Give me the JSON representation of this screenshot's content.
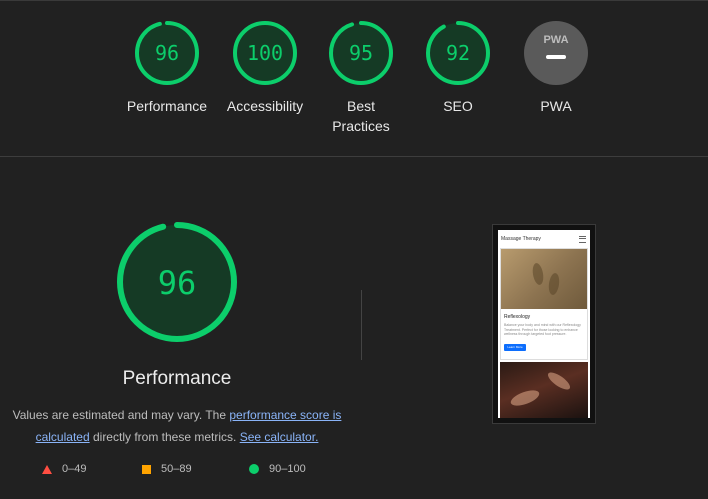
{
  "categories": [
    {
      "score": "96",
      "label": "Performance",
      "value": 96,
      "type": "score"
    },
    {
      "score": "100",
      "label": "Accessibility",
      "value": 100,
      "type": "score"
    },
    {
      "score": "95",
      "label": "Best Practices",
      "value": 95,
      "type": "score"
    },
    {
      "score": "92",
      "label": "SEO",
      "value": 92,
      "type": "score"
    },
    {
      "score": "PWA",
      "label": "PWA",
      "value": null,
      "type": "pwa"
    }
  ],
  "main": {
    "score": "96",
    "value": 96,
    "title": "Performance",
    "desc_part1": "Values are estimated and may vary. The ",
    "link_score": "performance score is calculated",
    "desc_part2": " directly from these metrics. ",
    "link_calc": "See calculator."
  },
  "legend": {
    "fail": "0–49",
    "average": "50–89",
    "pass": "90–100"
  },
  "screenshot": {
    "brand": "Massage Therapy",
    "card_title": "Reflexology",
    "card_text": "Balance your body and mind with our Reflexology Treatment. Perfect for those looking to enhance wellness through targeted foot pressure.",
    "button": "Learn More"
  },
  "colors": {
    "pass": "#0cce6b",
    "average": "#ffa400",
    "fail": "#ff4e42",
    "pass_bg": "#153a25",
    "neutral": "#5a5a5a"
  }
}
